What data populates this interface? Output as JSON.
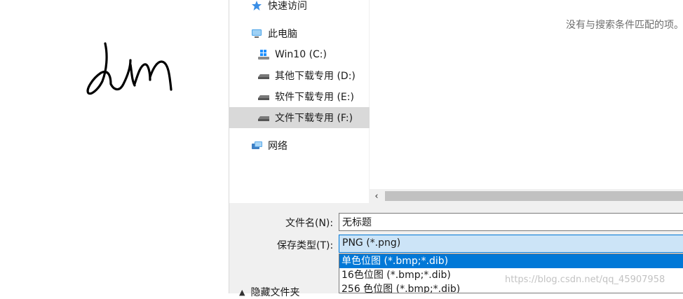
{
  "navigation": {
    "items": [
      {
        "label": "快速访问",
        "icon": "star-icon"
      },
      {
        "label": "此电脑",
        "icon": "computer-icon"
      },
      {
        "label": "Win10 (C:)",
        "icon": "windows-drive-icon"
      },
      {
        "label": "其他下载专用 (D:)",
        "icon": "drive-icon"
      },
      {
        "label": "软件下载专用 (E:)",
        "icon": "drive-icon"
      },
      {
        "label": "文件下载专用 (F:)",
        "icon": "drive-icon",
        "selected": true
      },
      {
        "label": "网络",
        "icon": "network-icon"
      }
    ]
  },
  "content": {
    "empty_message": "没有与搜索条件匹配的项。"
  },
  "save_form": {
    "filename_label": "文件名(N):",
    "filename_value": "无标题",
    "type_label": "保存类型(T):",
    "type_selected": "PNG (*.png)",
    "type_options": [
      "单色位图 (*.bmp;*.dib)",
      "16色位图 (*.bmp;*.dib)",
      "256 色位图 (*.bmp;*.dib)"
    ],
    "highlighted_option_index": 0,
    "hide_folders_label": "隐藏文件夹"
  },
  "watermark": "https://blog.csdn.net/qq_45907958",
  "colors": {
    "selection_blue": "#0078d7",
    "selected_nav_bg": "#d9d9d9",
    "select_field_bg": "#cce4f7",
    "dialog_bg": "#f0f0f0"
  }
}
